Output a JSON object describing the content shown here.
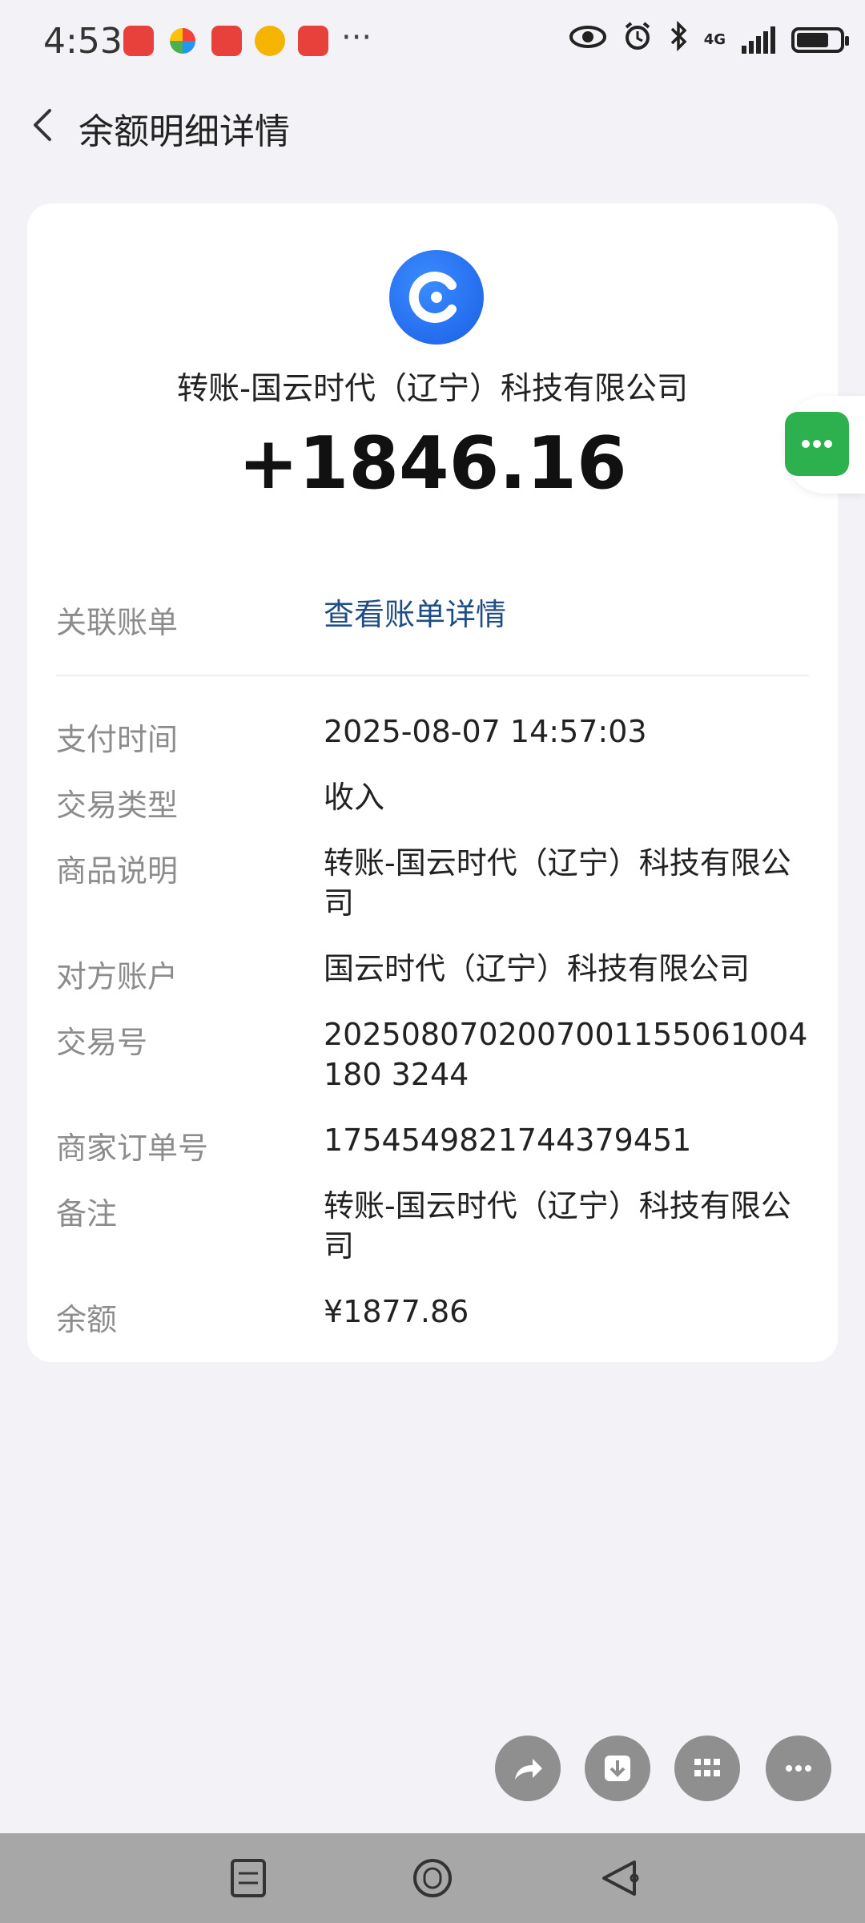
{
  "status_bar": {
    "time": "4:53",
    "more": "···",
    "network": "4G",
    "icons": [
      "eye-icon",
      "alarm-icon",
      "bluetooth-icon",
      "signal-icon",
      "battery-icon"
    ],
    "battery_level": 0.75
  },
  "header": {
    "title": "余额明细详情",
    "back_icon": "chevron-left-icon"
  },
  "card": {
    "payee": "转账-国云时代（辽宁）科技有限公司",
    "amount": "+1846.16",
    "linked_bill": {
      "label": "关联账单",
      "value": "查看账单详情"
    },
    "details": [
      {
        "label": "支付时间",
        "value": "2025-08-07 14:57:03"
      },
      {
        "label": "交易类型",
        "value": "收入"
      },
      {
        "label": "商品说明",
        "value": "转账-国云时代（辽宁）科技有限公司"
      },
      {
        "label": "对方账户",
        "value": "国云时代（辽宁）科技有限公司"
      },
      {
        "label": "交易号",
        "value": "2025080702007001155061004180 3244"
      },
      {
        "label": "商家订单号",
        "value": "1754549821744379451"
      },
      {
        "label": "备注",
        "value": "转账-国云时代（辽宁）科技有限公司"
      },
      {
        "label": "余额",
        "value": "¥1877.86"
      }
    ]
  },
  "actions": [
    "share-icon",
    "download-icon",
    "grid-icon",
    "more-icon"
  ],
  "colors": {
    "link": "#1f4e86",
    "accent_green": "#2db14e",
    "logo_blue": "#1a5fe6"
  }
}
